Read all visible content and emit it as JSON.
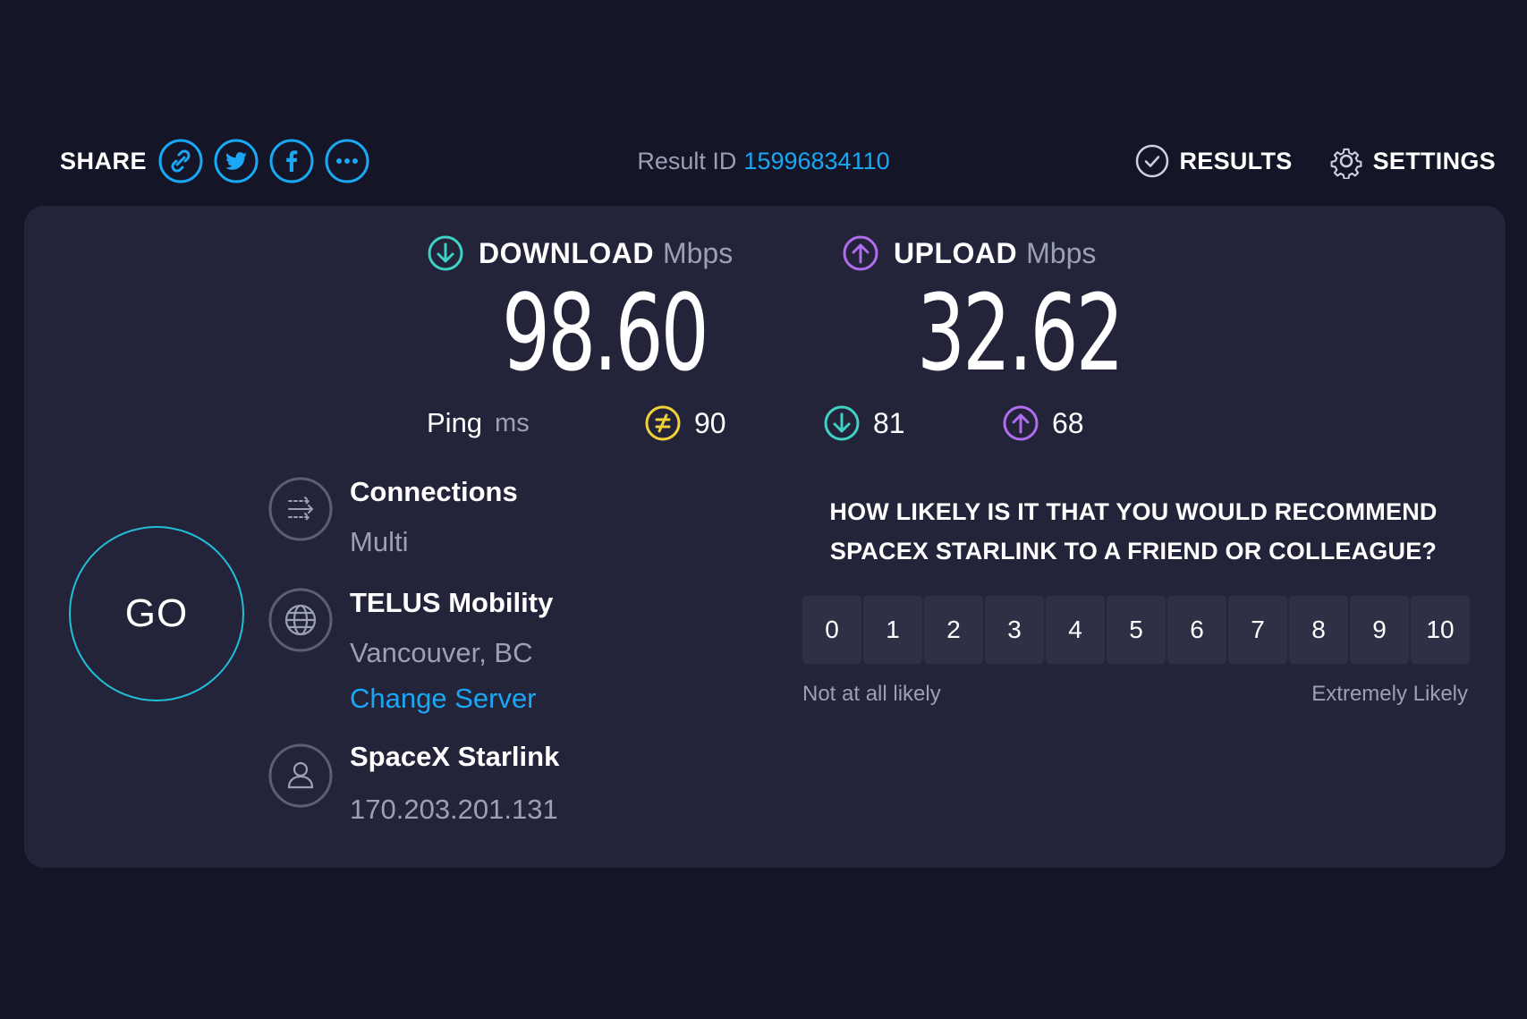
{
  "share": {
    "label": "SHARE",
    "buttons": [
      {
        "name": "link-icon"
      },
      {
        "name": "twitter-icon"
      },
      {
        "name": "facebook-icon"
      },
      {
        "name": "more-icon"
      }
    ]
  },
  "result": {
    "label": "Result ID",
    "id": "15996834110"
  },
  "nav": {
    "results": "RESULTS",
    "settings": "SETTINGS"
  },
  "download": {
    "label": "DOWNLOAD",
    "unit": "Mbps",
    "value": "98.60"
  },
  "upload": {
    "label": "UPLOAD",
    "unit": "Mbps",
    "value": "32.62"
  },
  "ping": {
    "label": "Ping",
    "unit": "ms",
    "idle": "90",
    "download": "81",
    "upload": "68"
  },
  "go": "GO",
  "connections": {
    "title": "Connections",
    "value": "Multi"
  },
  "server": {
    "name": "TELUS Mobility",
    "location": "Vancouver, BC",
    "change": "Change Server"
  },
  "provider": {
    "name": "SpaceX Starlink",
    "ip": "170.203.201.131"
  },
  "survey": {
    "question_line1": "HOW LIKELY IS IT THAT YOU WOULD RECOMMEND",
    "question_line2": "SPACEX STARLINK TO A FRIEND OR COLLEAGUE?",
    "options": [
      "0",
      "1",
      "2",
      "3",
      "4",
      "5",
      "6",
      "7",
      "8",
      "9",
      "10"
    ],
    "low_label": "Not at all likely",
    "high_label": "Extremely Likely"
  },
  "colors": {
    "background": "#141526",
    "panel": "#232439",
    "accent_blue": "#1aa7f3",
    "download": "#3fd1c4",
    "upload": "#b26cf0",
    "ping_idle": "#f2d23a",
    "go_ring": "#22bfd8"
  }
}
